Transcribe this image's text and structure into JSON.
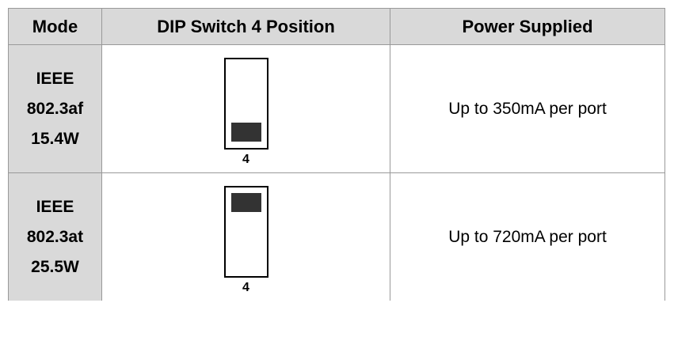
{
  "header": {
    "mode": "Mode",
    "dip": "DIP Switch 4 Position",
    "power": "Power Supplied"
  },
  "rows": [
    {
      "mode_lines": [
        "IEEE",
        "802.3af",
        "15.4W"
      ],
      "switch_label": "4",
      "switch_position": "down",
      "power": "Up to 350mA per port"
    },
    {
      "mode_lines": [
        "IEEE",
        "802.3at",
        "25.5W"
      ],
      "switch_label": "4",
      "switch_position": "up",
      "power": "Up to 720mA per port"
    }
  ],
  "colors": {
    "header_bg": "#d9d9d9",
    "mode_bg": "#d9d9d9",
    "border": "#999999",
    "slider": "#333333"
  }
}
